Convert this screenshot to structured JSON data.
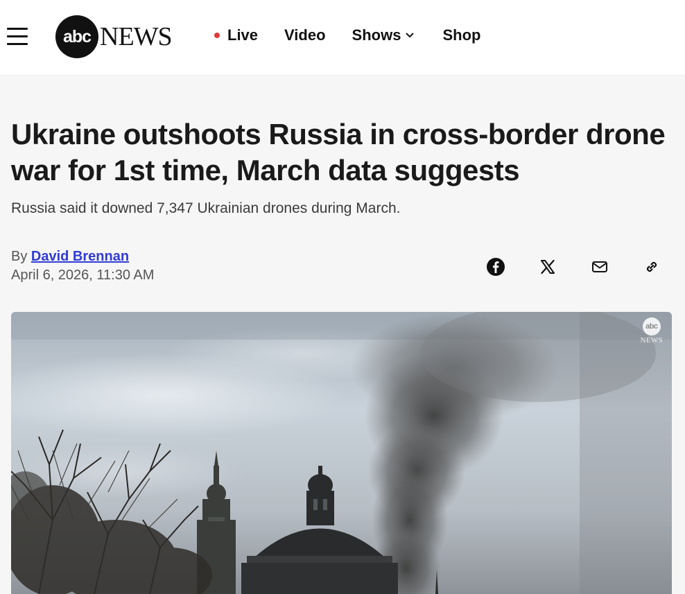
{
  "header": {
    "logo": {
      "mark": "abc",
      "word": "NEWS"
    },
    "nav": {
      "live": "Live",
      "video": "Video",
      "shows": "Shows",
      "shop": "Shop"
    },
    "icons": {
      "menu": "hamburger-menu-icon",
      "live_dot_color": "#e03a3a",
      "shows_dropdown": "chevron-down-icon"
    }
  },
  "article": {
    "headline": "Ukraine outshoots Russia in cross-border drone war for 1st time, March data suggests",
    "dek": "Russia said it downed 7,347 Ukrainian drones during March.",
    "byline_prefix": "By",
    "author": "David Brennan",
    "date": "April 6, 2026, 11:30 AM",
    "author_link_color": "#2f3bd6"
  },
  "share": {
    "icons": [
      "facebook-icon",
      "x-icon",
      "email-icon",
      "link-icon"
    ]
  },
  "hero": {
    "watermark": {
      "mark": "abc",
      "word": "NEWS"
    }
  }
}
